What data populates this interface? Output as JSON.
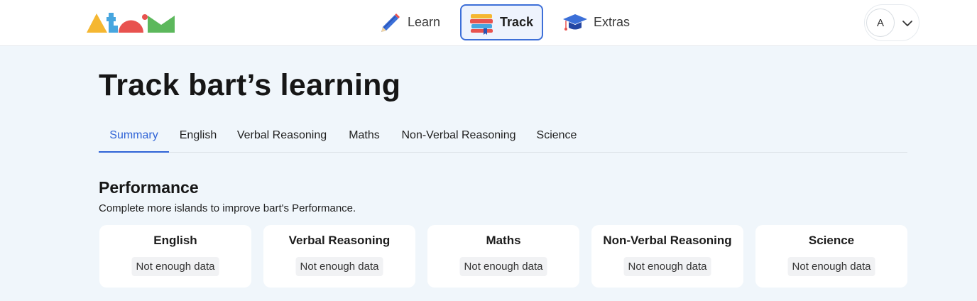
{
  "logo": {
    "name": "atom-logo",
    "colors": [
      "#f5b731",
      "#47a6df",
      "#e8524f",
      "#5cb85c"
    ]
  },
  "nav": {
    "items": [
      {
        "label": "Learn",
        "icon": "pencil-icon",
        "active": false
      },
      {
        "label": "Track",
        "icon": "books-icon",
        "active": true
      },
      {
        "label": "Extras",
        "icon": "graduation-cap-icon",
        "active": false
      }
    ]
  },
  "account": {
    "initial": "A",
    "menu_icon": "chevron-down-icon"
  },
  "page": {
    "title": "Track bart’s learning"
  },
  "tabs": [
    {
      "label": "Summary",
      "active": true
    },
    {
      "label": "English",
      "active": false
    },
    {
      "label": "Verbal Reasoning",
      "active": false
    },
    {
      "label": "Maths",
      "active": false
    },
    {
      "label": "Non-Verbal Reasoning",
      "active": false
    },
    {
      "label": "Science",
      "active": false
    }
  ],
  "performance": {
    "title": "Performance",
    "subtitle": "Complete more islands to improve bart's Performance.",
    "cards": [
      {
        "subject": "English",
        "status": "Not enough data"
      },
      {
        "subject": "Verbal Reasoning",
        "status": "Not enough data"
      },
      {
        "subject": "Maths",
        "status": "Not enough data"
      },
      {
        "subject": "Non-Verbal Reasoning",
        "status": "Not enough data"
      },
      {
        "subject": "Science",
        "status": "Not enough data"
      }
    ]
  },
  "colors": {
    "accent": "#2f63d6",
    "page_background": "#f0f6fb",
    "card_background": "#ffffff",
    "badge_background": "#f1f2f4"
  }
}
